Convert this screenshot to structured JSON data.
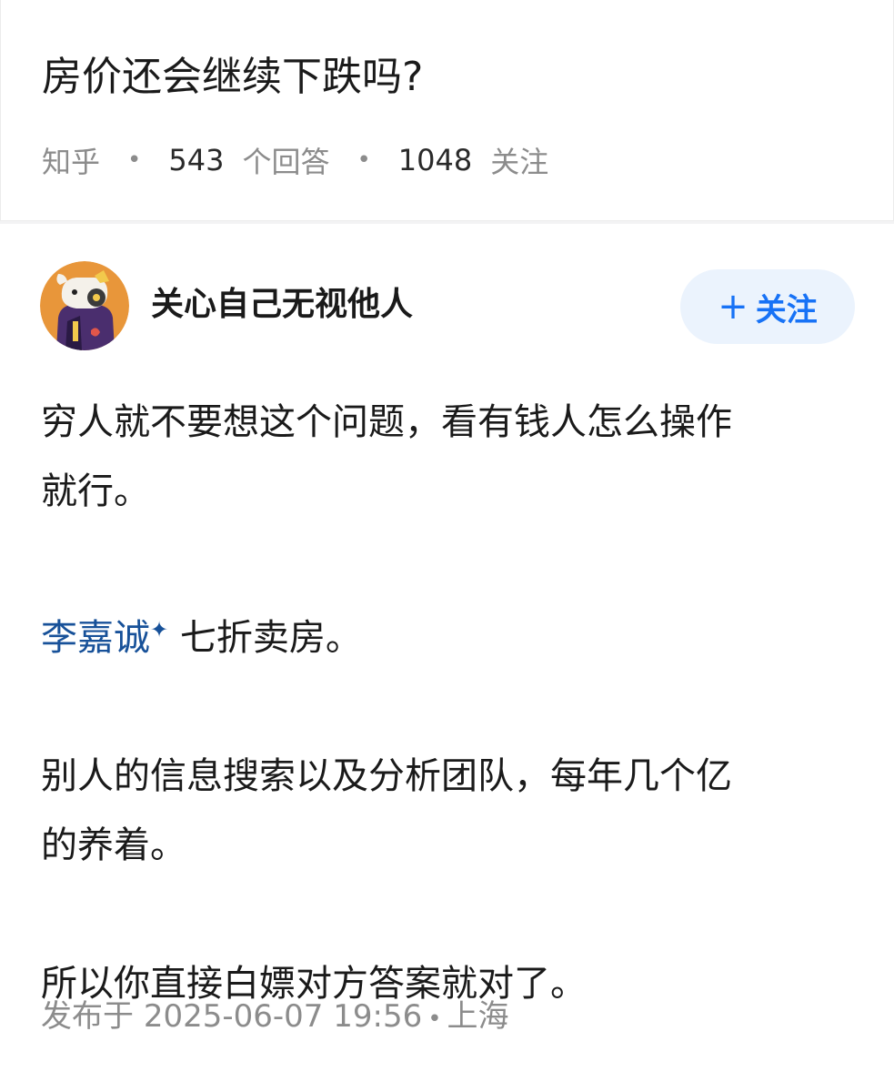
{
  "question": {
    "title": "房价还会继续下跌吗?",
    "source": "知乎",
    "answer_count": "543",
    "answer_count_label": "个回答",
    "follow_count": "1048",
    "follow_count_label": "关注",
    "separator": "•"
  },
  "answer": {
    "author_name": "关心自己无视他人",
    "avatar_icon": "cartoon-dog-avatar-icon",
    "follow_button": {
      "plus": "+",
      "label": "关注"
    },
    "paragraphs": {
      "p1_line1": "穷人就不要想这个问题，看有钱人怎么操作",
      "p1_line2": "就行。",
      "p2_link": "李嘉诚",
      "p2_link_icon": "✦",
      "p2_rest": "七折卖房。",
      "p3_line1": "别人的信息搜索以及分析团队，每年几个亿",
      "p3_line2": "的养着。",
      "p4": "所以你直接白嫖对方答案就对了。"
    },
    "publish": {
      "prefix": "发布于",
      "date": "2025-06-07",
      "time": "19:56",
      "separator": "•",
      "location": "上海"
    }
  },
  "colors": {
    "accent": "#1772f6",
    "link": "#175199",
    "muted": "#8c8c8c",
    "follow_bg": "#ebf3fd"
  }
}
